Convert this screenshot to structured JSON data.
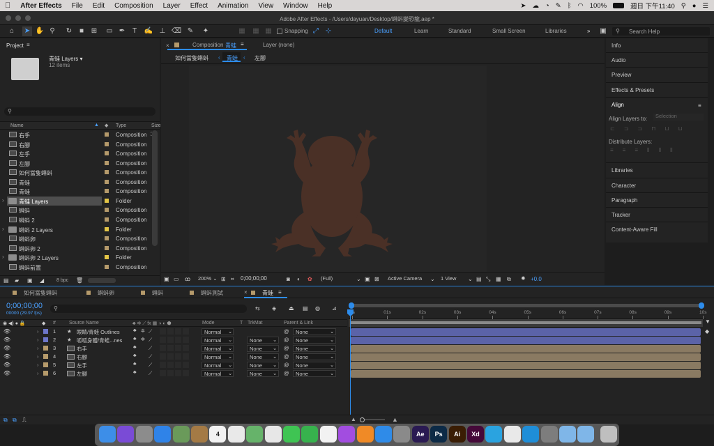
{
  "menubar": {
    "apple": "",
    "app_name": "After Effects",
    "items": [
      "File",
      "Edit",
      "Composition",
      "Layer",
      "Effect",
      "Animation",
      "View",
      "Window",
      "Help"
    ],
    "battery": "100%",
    "clock": "週日 下午11:40"
  },
  "window": {
    "title": "Adobe After Effects - /Users/dayuan/Desktop/蝌蚪變恐龍.aep *"
  },
  "toolbar": {
    "snapping": "Snapping",
    "workspaces": [
      "Default",
      "Learn",
      "Standard",
      "Small Screen",
      "Libraries"
    ],
    "active_workspace": "Default",
    "more": "»",
    "search_placeholder": "Search Help"
  },
  "project": {
    "tab": "Project",
    "selected_name": "青蛙 Layers ▾",
    "selected_count": "12 items",
    "search_placeholder": "",
    "col_name": "Name",
    "col_type": "Type",
    "col_size": "Size",
    "bpc": "8 bpc",
    "items": [
      {
        "name": "右手",
        "type": "Composition",
        "kind": "comp",
        "label": "#b59a6b",
        "expand": ""
      },
      {
        "name": "右腳",
        "type": "Composition",
        "kind": "comp",
        "label": "#b59a6b",
        "expand": ""
      },
      {
        "name": "左手",
        "type": "Composition",
        "kind": "comp",
        "label": "#b59a6b",
        "expand": ""
      },
      {
        "name": "左腳",
        "type": "Composition",
        "kind": "comp",
        "label": "#b59a6b",
        "expand": ""
      },
      {
        "name": "如何當隻蝌蚪",
        "type": "Composition",
        "kind": "comp",
        "label": "#b59a6b",
        "expand": ""
      },
      {
        "name": "青蛙",
        "type": "Composition",
        "kind": "comp",
        "label": "#b59a6b",
        "expand": ""
      },
      {
        "name": "青蛙",
        "type": "Composition",
        "kind": "comp",
        "label": "#b59a6b",
        "expand": ""
      },
      {
        "name": "青蛙 Layers",
        "type": "Folder",
        "kind": "folder",
        "label": "#e3c546",
        "expand": "›"
      },
      {
        "name": "蝌蚪",
        "type": "Composition",
        "kind": "comp",
        "label": "#b59a6b",
        "expand": ""
      },
      {
        "name": "蝌蚪 2",
        "type": "Composition",
        "kind": "comp",
        "label": "#b59a6b",
        "expand": ""
      },
      {
        "name": "蝌蚪 2 Layers",
        "type": "Folder",
        "kind": "folder",
        "label": "#e3c546",
        "expand": "›"
      },
      {
        "name": "蝌蚪卵",
        "type": "Composition",
        "kind": "comp",
        "label": "#b59a6b",
        "expand": ""
      },
      {
        "name": "蝌蚪卵 2",
        "type": "Composition",
        "kind": "comp",
        "label": "#b59a6b",
        "expand": ""
      },
      {
        "name": "蝌蚪卵 2 Layers",
        "type": "Folder",
        "kind": "folder",
        "label": "#e3c546",
        "expand": "›"
      },
      {
        "name": "蝌蚪前置",
        "type": "Composition",
        "kind": "comp",
        "label": "#b59a6b",
        "expand": ""
      }
    ]
  },
  "composition": {
    "tab_prefix": "Composition",
    "tab_name": "青蛙",
    "layer_tab": "Layer (none)",
    "breadcrumbs": [
      "如何當隻蝌蚪",
      "青蛙",
      "左腳"
    ],
    "zoom": "200%",
    "timecode": "0;00;00;00",
    "resolution": "(Full)",
    "camera": "Active Camera",
    "views": "1 View",
    "exposure": "+0.0"
  },
  "right_panels": [
    "Info",
    "Audio",
    "Preview",
    "Effects & Presets",
    "Align",
    "Libraries",
    "Character",
    "Paragraph",
    "Tracker",
    "Content-Aware Fill"
  ],
  "align": {
    "align_to_label": "Align Layers to:",
    "align_to_value": "Selection",
    "distribute_label": "Distribute Layers:"
  },
  "timeline": {
    "tabs": [
      "如何當隻蝌蚪",
      "蝌蚪卵",
      "蝌蚪",
      "蝌蚪測試",
      "青蛙"
    ],
    "active_tab": "青蛙",
    "timecode": "0;00;00;00",
    "fps": "00000 (29.97 fps)",
    "search_placeholder": "",
    "col_num": "#",
    "col_source": "Source Name",
    "col_mode": "Mode",
    "col_t": "T",
    "col_trkmat": "TrkMat",
    "col_parent": "Parent & Link",
    "ruler": [
      "0s",
      "01s",
      "02s",
      "03s",
      "04s",
      "05s",
      "06s",
      "07s",
      "08s",
      "09s",
      "10s"
    ],
    "layers": [
      {
        "num": "1",
        "name": "眼睛/青蛙 Outlines",
        "kind": "shape",
        "color": "#6d76c9",
        "mode": "Normal",
        "trkmat": "",
        "parent": "None",
        "bar": "#5b63a8"
      },
      {
        "num": "2",
        "name": "呱呱身體/青蛙...nes",
        "kind": "shape",
        "color": "#6d76c9",
        "mode": "Normal",
        "trkmat": "None",
        "parent": "None",
        "bar": "#5b63a8"
      },
      {
        "num": "3",
        "name": "右手",
        "kind": "comp",
        "color": "#b59a6b",
        "mode": "Normal",
        "trkmat": "None",
        "parent": "None",
        "bar": "#8a7a62"
      },
      {
        "num": "4",
        "name": "右腳",
        "kind": "comp",
        "color": "#b59a6b",
        "mode": "Normal",
        "trkmat": "None",
        "parent": "None",
        "bar": "#8a7a62"
      },
      {
        "num": "5",
        "name": "左手",
        "kind": "comp",
        "color": "#b59a6b",
        "mode": "Normal",
        "trkmat": "None",
        "parent": "None",
        "bar": "#8a7a62"
      },
      {
        "num": "6",
        "name": "左腳",
        "kind": "comp",
        "color": "#b59a6b",
        "mode": "Normal",
        "trkmat": "None",
        "parent": "None",
        "bar": "#8a7a62"
      }
    ]
  },
  "dock": [
    {
      "name": "Finder",
      "label": "",
      "color": "#3d8ee8"
    },
    {
      "name": "Siri",
      "label": "",
      "color": "#7a4bd6"
    },
    {
      "name": "Launchpad",
      "label": "",
      "color": "#8c8c8c"
    },
    {
      "name": "Safari",
      "label": "",
      "color": "#2f83e8"
    },
    {
      "name": "Preview",
      "label": "",
      "color": "#6a9a5a"
    },
    {
      "name": "Notes",
      "label": "",
      "color": "#a47a45"
    },
    {
      "name": "Calendar",
      "label": "4",
      "color": "#f2f2f2"
    },
    {
      "name": "Reminders",
      "label": "",
      "color": "#e9e9e9"
    },
    {
      "name": "Maps",
      "label": "",
      "color": "#66b36a"
    },
    {
      "name": "Photos",
      "label": "",
      "color": "#e7e7e7"
    },
    {
      "name": "Messages",
      "label": "",
      "color": "#3fc453"
    },
    {
      "name": "FaceTime",
      "label": "",
      "color": "#37b24d"
    },
    {
      "name": "Music",
      "label": "",
      "color": "#f2f2f2"
    },
    {
      "name": "Podcasts",
      "label": "",
      "color": "#a24de0"
    },
    {
      "name": "Books",
      "label": "",
      "color": "#f08a26"
    },
    {
      "name": "App Store",
      "label": "",
      "color": "#2f8be8"
    },
    {
      "name": "System Preferences",
      "label": "",
      "color": "#8a8a8a"
    },
    {
      "name": "After Effects",
      "label": "Ae",
      "color": "#2a1a52"
    },
    {
      "name": "Photoshop",
      "label": "Ps",
      "color": "#0c2a46"
    },
    {
      "name": "Illustrator",
      "label": "Ai",
      "color": "#3a1d04"
    },
    {
      "name": "XD",
      "label": "Xd",
      "color": "#450939"
    },
    {
      "name": "Telegram",
      "label": "",
      "color": "#2aa3e0"
    },
    {
      "name": "Chrome",
      "label": "",
      "color": "#e9e9e9"
    },
    {
      "name": "Edge",
      "label": "",
      "color": "#1f8ed8"
    },
    {
      "name": "Image Capture",
      "label": "",
      "color": "#7d7d7d"
    },
    {
      "name": "Folder",
      "label": "",
      "color": "#7fb6e8"
    },
    {
      "name": "Downloads",
      "label": "",
      "color": "#7fb6e8"
    },
    {
      "name": "Trash",
      "label": "",
      "color": "#bfbfbf"
    }
  ],
  "colors": {
    "accent": "#2d8ceb",
    "frog": "#4a3026"
  }
}
